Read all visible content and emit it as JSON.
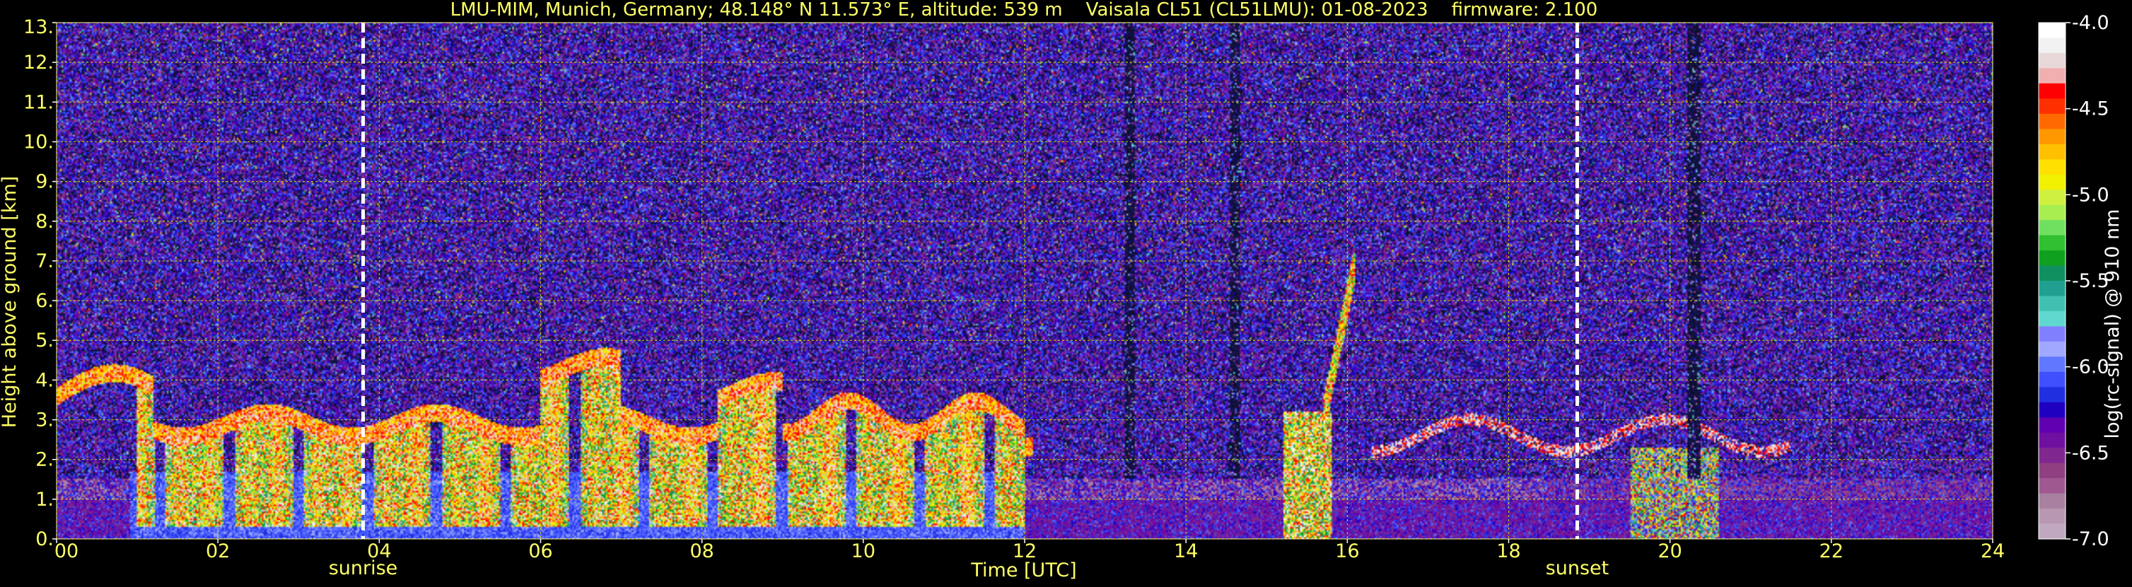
{
  "chart_data": {
    "type": "heatmap",
    "title": "LMU-MIM, Munich, Germany; 48.148° N 11.573° E, altitude: 539 m    Vaisala CL51 (CL51LMU): 01-08-2023    firmware: 2.100",
    "xlabel": "Time [UTC]",
    "ylabel": "Height above ground [km]",
    "xlim": [
      0,
      24
    ],
    "ylim": [
      0,
      13
    ],
    "x_ticks": [
      "00",
      "02",
      "04",
      "06",
      "08",
      "10",
      "12",
      "14",
      "16",
      "18",
      "20",
      "22",
      "24"
    ],
    "y_ticks": [
      "0.",
      "1.",
      "2.",
      "3.",
      "4.",
      "5.",
      "6.",
      "7.",
      "8.",
      "9.",
      "10.",
      "11.",
      "12.",
      "13."
    ],
    "grid": true,
    "annotations": [
      {
        "label": "sunrise",
        "x": 3.8
      },
      {
        "label": "sunset",
        "x": 18.85
      }
    ],
    "colorbar": {
      "label": "log(rc-signal) @ 910 nm",
      "range": [
        -7.0,
        -4.0
      ],
      "ticks": [
        "-4.0",
        "-4.5",
        "-5.0",
        "-5.5",
        "-6.0",
        "-6.5",
        "-7.0"
      ],
      "tick_values": [
        -4.0,
        -4.5,
        -5.0,
        -5.5,
        -6.0,
        -6.5,
        -7.0
      ],
      "colors": [
        "#ffffff",
        "#f2f2f2",
        "#e8d8d8",
        "#f0b0b0",
        "#ff0000",
        "#ff3000",
        "#ff6a00",
        "#ff9800",
        "#ffc000",
        "#ffe000",
        "#f0f000",
        "#d0f040",
        "#a8ee50",
        "#70e060",
        "#30c030",
        "#10a020",
        "#109060",
        "#20a090",
        "#40c0b0",
        "#60d8d0",
        "#8080ff",
        "#a0a8ff",
        "#6078ff",
        "#4050ff",
        "#2030e0",
        "#2000c0",
        "#6000b0",
        "#7010a0",
        "#802890",
        "#904080",
        "#a05890",
        "#a880a0",
        "#b898b0",
        "#c0a8c0"
      ]
    },
    "description": "Ceilometer attenuated backscatter time-height cross-section"
  }
}
